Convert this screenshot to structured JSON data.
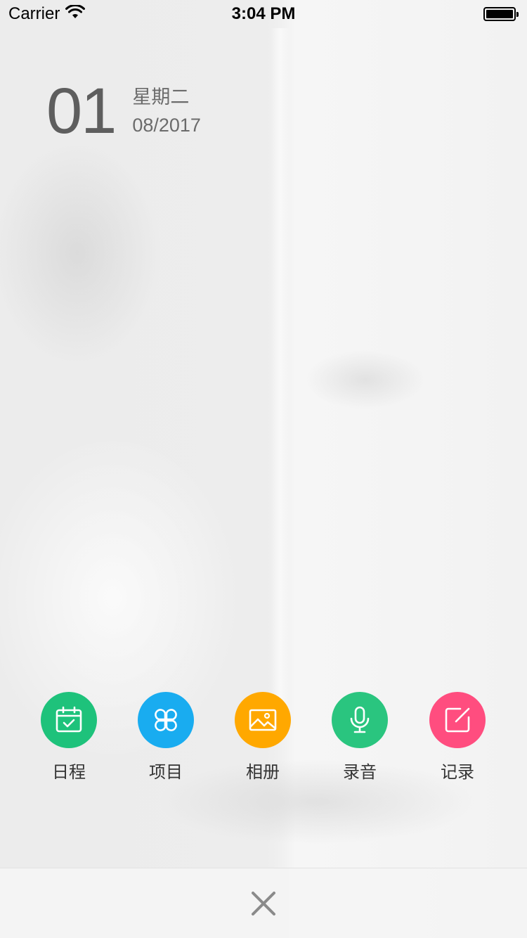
{
  "status_bar": {
    "carrier": "Carrier",
    "time": "3:04 PM",
    "wifi_icon": "wifi-icon",
    "battery_icon": "battery-icon"
  },
  "date": {
    "day": "01",
    "weekday": "星期二",
    "month_year": "08/2017"
  },
  "actions": [
    {
      "label": "日程",
      "icon": "calendar-icon",
      "color": "#1ec27b"
    },
    {
      "label": "项目",
      "icon": "four-leaf-icon",
      "color": "#19acf0"
    },
    {
      "label": "相册",
      "icon": "image-icon",
      "color": "#ffa800"
    },
    {
      "label": "录音",
      "icon": "microphone-icon",
      "color": "#2ac57f"
    },
    {
      "label": "记录",
      "icon": "edit-note-icon",
      "color": "#ff4d7f"
    }
  ],
  "bottom_bar": {
    "close_icon": "close-icon",
    "close_color": "#8a8a8a"
  }
}
